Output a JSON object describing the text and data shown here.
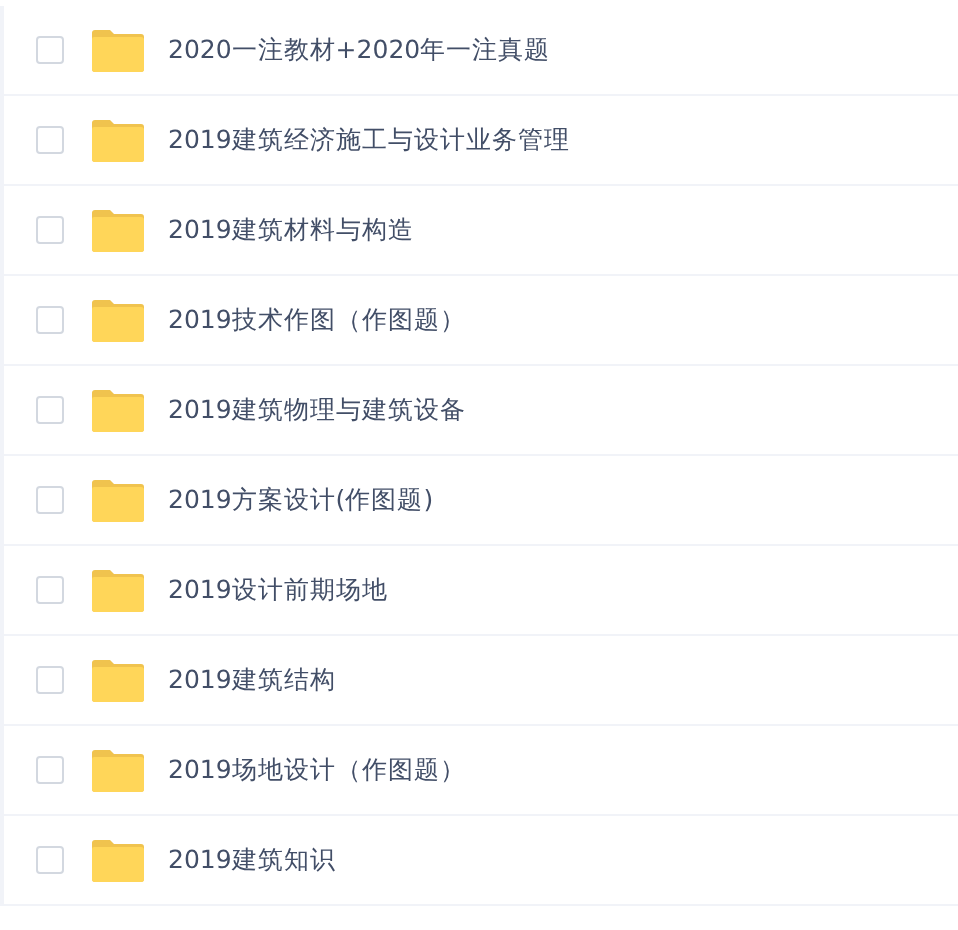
{
  "files": [
    {
      "name": "2020一注教材+2020年一注真题",
      "checked": false
    },
    {
      "name": "2019建筑经济施工与设计业务管理",
      "checked": false
    },
    {
      "name": "2019建筑材料与构造",
      "checked": false
    },
    {
      "name": "2019技术作图（作图题）",
      "checked": false
    },
    {
      "name": "2019建筑物理与建筑设备",
      "checked": false
    },
    {
      "name": "2019方案设计(作图题)",
      "checked": false
    },
    {
      "name": "2019设计前期场地",
      "checked": false
    },
    {
      "name": "2019建筑结构",
      "checked": false
    },
    {
      "name": "2019场地设计（作图题）",
      "checked": false
    },
    {
      "name": "2019建筑知识",
      "checked": false
    }
  ]
}
